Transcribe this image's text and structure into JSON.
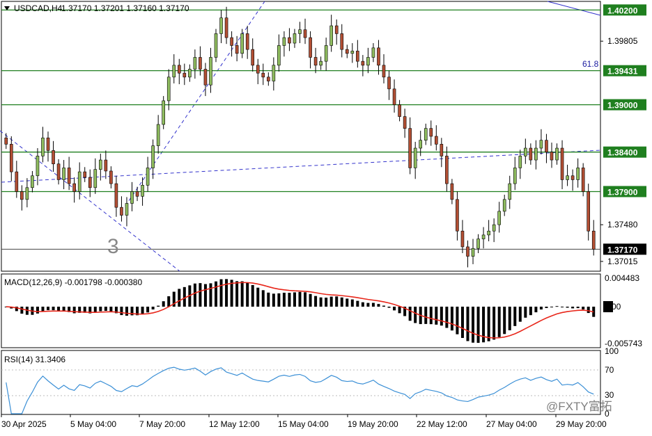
{
  "header": {
    "symbol": "USDCAD,H4",
    "ohlc": "1.37170 1.37201 1.37160 1.37170",
    "menu_icon": "triangle-down-icon"
  },
  "annotations": {
    "wave_label": "3",
    "fib_label": "61.8"
  },
  "macd_label": "MACD(12,26,9) -0.001798 -0.000380",
  "rsi_label": "RSI(14) 31.3406",
  "watermark": "@FXTY富拓",
  "colors": {
    "bull": "#8fbc5f",
    "bear": "#b24f34",
    "level": "#1f7f1f",
    "price_badge": "#000000",
    "trend": "#3333cc",
    "signal": "#e8261a",
    "rsi": "#3a8fd6"
  },
  "chart_data": [
    {
      "type": "candlestick",
      "title": "USDCAD,H4",
      "ylim": [
        1.369,
        1.403
      ],
      "y_ticks": [
        "1.40200",
        "1.39805",
        "1.39431",
        "1.39000",
        "1.38400",
        "1.37900",
        "1.37480",
        "1.37170",
        "1.37015"
      ],
      "x_ticks": [
        "30 Apr 2025",
        "5 May 04:00",
        "7 May 20:00",
        "12 May 12:00",
        "15 May 04:00",
        "19 May 20:00",
        "22 May 12:00",
        "27 May 04:00",
        "29 May 20:00"
      ],
      "horizontal_levels": [
        1.402,
        1.39431,
        1.39,
        1.384,
        1.379
      ],
      "current_price": 1.3717,
      "closes": [
        1.385,
        1.3815,
        1.379,
        1.378,
        1.3795,
        1.381,
        1.3835,
        1.3858,
        1.3842,
        1.3825,
        1.3805,
        1.382,
        1.38,
        1.379,
        1.3815,
        1.3808,
        1.3795,
        1.3818,
        1.383,
        1.3816,
        1.38,
        1.377,
        1.376,
        1.3775,
        1.379,
        1.3784,
        1.3798,
        1.382,
        1.3848,
        1.3875,
        1.3905,
        1.3935,
        1.395,
        1.394,
        1.3935,
        1.3945,
        1.396,
        1.3945,
        1.3925,
        1.396,
        1.399,
        1.401,
        1.3985,
        1.3975,
        1.3965,
        1.399,
        1.397,
        1.395,
        1.394,
        1.3935,
        1.393,
        1.395,
        1.3975,
        1.3985,
        1.3978,
        1.399,
        1.3995,
        1.3985,
        1.396,
        1.395,
        1.3955,
        1.3975,
        1.4,
        1.399,
        1.397,
        1.3965,
        1.3968,
        1.3955,
        1.395,
        1.396,
        1.3972,
        1.395,
        1.3935,
        1.392,
        1.39,
        1.3885,
        1.387,
        1.382,
        1.3845,
        1.3855,
        1.387,
        1.386,
        1.385,
        1.3835,
        1.38,
        1.378,
        1.374,
        1.372,
        1.3708,
        1.3718,
        1.373,
        1.3735,
        1.374,
        1.3748,
        1.3765,
        1.378,
        1.38,
        1.382,
        1.3835,
        1.3845,
        1.383,
        1.3845,
        1.3855,
        1.384,
        1.383,
        1.3845,
        1.3805,
        1.381,
        1.3805,
        1.382,
        1.379,
        1.374,
        1.3717
      ],
      "macd": {
        "name": "MACD(12,26,9)",
        "value": -0.001798,
        "signal_value": -0.00038,
        "ticks": [
          "0.004483",
          "0.00",
          "-0.005743"
        ],
        "ylim": [
          -0.0063,
          0.005
        ]
      },
      "rsi": {
        "name": "RSI(14)",
        "value": 31.3406,
        "ticks": [
          "100",
          "70",
          "30",
          "0"
        ],
        "levels": [
          30,
          70
        ],
        "ylim": [
          0,
          100
        ]
      }
    }
  ]
}
